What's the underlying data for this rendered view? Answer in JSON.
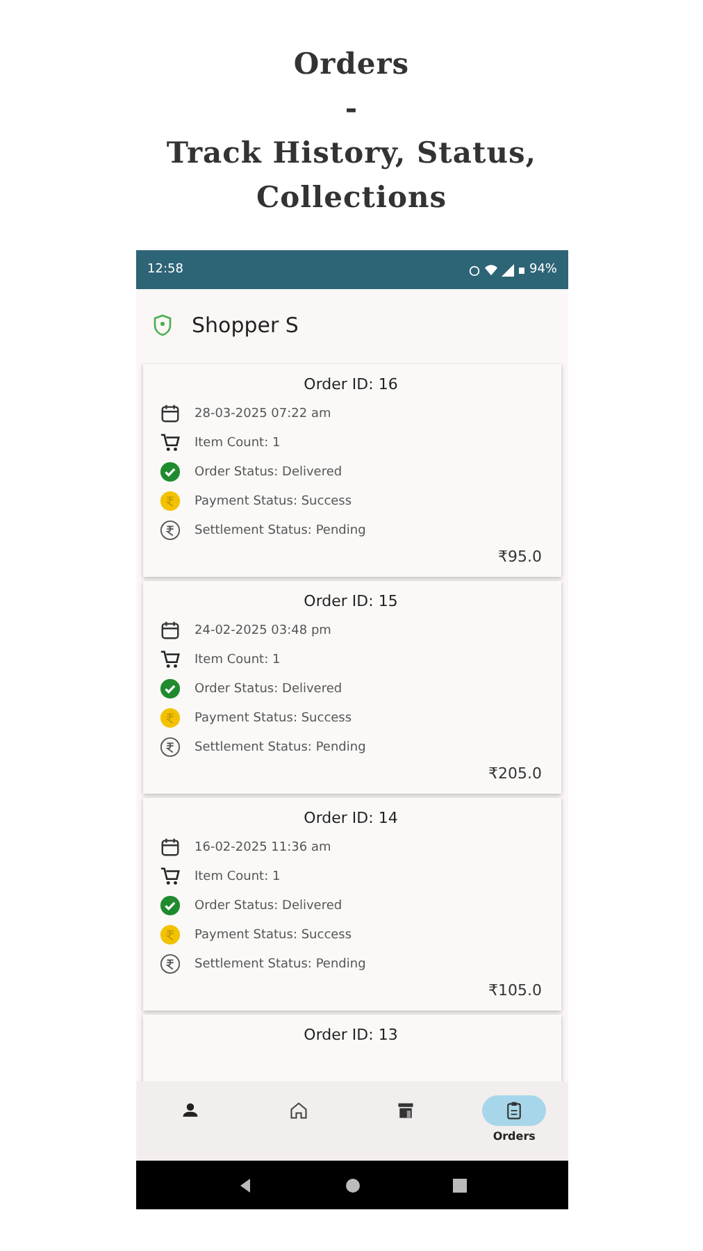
{
  "heading": [
    "Orders",
    "-",
    "Track History, Status,",
    "Collections"
  ],
  "status_bar": {
    "time": "12:58",
    "battery": "94%"
  },
  "app_bar": {
    "title": "Shopper S"
  },
  "orders": [
    {
      "title": "Order ID: 16",
      "rows": [
        {
          "kind": "date",
          "text": "28-03-2025 07:22 am"
        },
        {
          "kind": "items",
          "text": "Item Count: 1"
        },
        {
          "kind": "order",
          "text": "Order Status: Delivered"
        },
        {
          "kind": "payment",
          "text": "Payment Status: Success"
        },
        {
          "kind": "settlement",
          "text": "Settlement Status: Pending"
        }
      ],
      "amount": "₹95.0"
    },
    {
      "title": "Order ID: 15",
      "rows": [
        {
          "kind": "date",
          "text": "24-02-2025 03:48 pm"
        },
        {
          "kind": "items",
          "text": "Item Count: 1"
        },
        {
          "kind": "order",
          "text": "Order Status: Delivered"
        },
        {
          "kind": "payment",
          "text": "Payment Status: Success"
        },
        {
          "kind": "settlement",
          "text": "Settlement Status: Pending"
        }
      ],
      "amount": "₹205.0"
    },
    {
      "title": "Order ID: 14",
      "rows": [
        {
          "kind": "date",
          "text": "16-02-2025 11:36 am"
        },
        {
          "kind": "items",
          "text": "Item Count: 1"
        },
        {
          "kind": "order",
          "text": "Order Status: Delivered"
        },
        {
          "kind": "payment",
          "text": "Payment Status: Success"
        },
        {
          "kind": "settlement",
          "text": "Settlement Status: Pending"
        }
      ],
      "amount": "₹105.0"
    },
    {
      "title": "Order ID: 13"
    }
  ],
  "nav": [
    {
      "kind": "profile",
      "selected": false
    },
    {
      "kind": "home",
      "selected": false
    },
    {
      "kind": "store",
      "selected": false
    },
    {
      "kind": "orders",
      "label": "Orders",
      "selected": true
    }
  ]
}
